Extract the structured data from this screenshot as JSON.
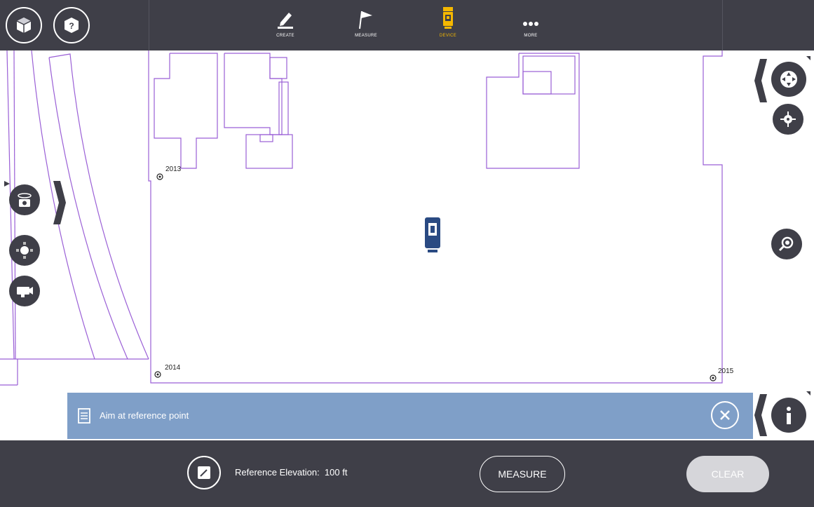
{
  "toolbar": {
    "tools": [
      {
        "label": "CREATE",
        "icon": "pencil-icon"
      },
      {
        "label": "MEASURE",
        "icon": "flag-icon"
      },
      {
        "label": "DEVICE",
        "icon": "total-station-icon",
        "active": true
      },
      {
        "label": "MORE",
        "icon": "more-dots-icon"
      }
    ],
    "left_buttons": [
      "cube-view-icon",
      "help-icon"
    ],
    "active_color": "#f5b800",
    "bar_color": "#3f3f48"
  },
  "map": {
    "line_color": "#9a5fd6",
    "points": [
      {
        "label": "2013"
      },
      {
        "label": "2014"
      },
      {
        "label": "2015"
      }
    ]
  },
  "left_tools": [
    "camera-360-icon",
    "target-icon",
    "video-camera-icon"
  ],
  "right_tools": [
    "pan-icon",
    "center-icon",
    "zoom-icon"
  ],
  "message": {
    "text": "Aim at reference point",
    "bar_color": "#7f9fc8"
  },
  "bottom": {
    "reference_elevation": "Reference Elevation:  100 ft",
    "measure_label": "MEASURE",
    "clear_label": "CLEAR"
  }
}
